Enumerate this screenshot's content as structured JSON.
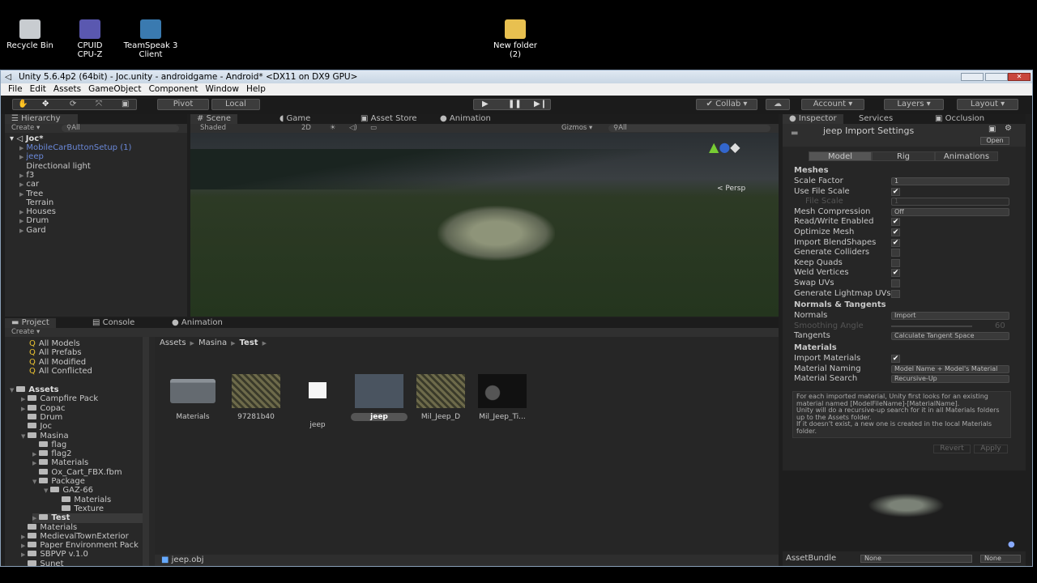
{
  "desktop": {
    "icons": [
      {
        "label": "Recycle Bin"
      },
      {
        "label": "CPUID\nCPU-Z"
      },
      {
        "label": "TeamSpeak 3\nClient"
      },
      {
        "label": "New folder\n(2)"
      }
    ]
  },
  "window": {
    "title": "Unity 5.6.4p2 (64bit) - Joc.unity - androidgame - Android* <DX11 on DX9 GPU>"
  },
  "menu": [
    "File",
    "Edit",
    "Assets",
    "GameObject",
    "Component",
    "Window",
    "Help"
  ],
  "toolbar": {
    "pivot": "Pivot",
    "local": "Local",
    "collab": "Collab",
    "account": "Account",
    "layers": "Layers",
    "layout": "Layout"
  },
  "hierarchy": {
    "tab": "Hierarchy",
    "create": "Create",
    "search_placeholder": "All",
    "scene": "Joc*",
    "items": [
      {
        "label": "MobileCarButtonSetup (1)",
        "prefab": true,
        "arrow": true
      },
      {
        "label": "jeep",
        "prefab": true,
        "arrow": true
      },
      {
        "label": "Directional light",
        "arrow": false
      },
      {
        "label": "f3",
        "arrow": true
      },
      {
        "label": "car",
        "arrow": true
      },
      {
        "label": "Tree",
        "arrow": true
      },
      {
        "label": "Terrain",
        "arrow": false
      },
      {
        "label": "Houses",
        "arrow": true
      },
      {
        "label": "Drum",
        "arrow": true
      },
      {
        "label": "Gard",
        "arrow": true
      }
    ]
  },
  "scene": {
    "tabs": [
      "Scene",
      "Game",
      "Asset Store",
      "Animation"
    ],
    "shading": "Shaded",
    "mode_2d": "2D",
    "gizmos": "Gizmos",
    "search_placeholder": "All",
    "projection": "Persp"
  },
  "project": {
    "tabs": [
      "Project",
      "Console",
      "Animation"
    ],
    "create": "Create",
    "favorites": [
      "All Models",
      "All Prefabs",
      "All Modified",
      "All Conflicted"
    ],
    "tree": [
      {
        "label": "Assets",
        "depth": 0,
        "open": true,
        "bold": true
      },
      {
        "label": "Campfire Pack",
        "depth": 1,
        "arrow": true
      },
      {
        "label": "Copac",
        "depth": 1,
        "arrow": true
      },
      {
        "label": "Drum",
        "depth": 1
      },
      {
        "label": "Joc",
        "depth": 1
      },
      {
        "label": "Masina",
        "depth": 1,
        "open": true
      },
      {
        "label": "flag",
        "depth": 2
      },
      {
        "label": "flag2",
        "depth": 2,
        "arrow": true
      },
      {
        "label": "Materials",
        "depth": 2,
        "arrow": true
      },
      {
        "label": "Ox_Cart_FBX.fbm",
        "depth": 2
      },
      {
        "label": "Package",
        "depth": 2,
        "open": true
      },
      {
        "label": "GAZ-66",
        "depth": 3,
        "open": true
      },
      {
        "label": "Materials",
        "depth": 4
      },
      {
        "label": "Texture",
        "depth": 4
      },
      {
        "label": "Test",
        "depth": 2,
        "arrow": true,
        "selected": true
      },
      {
        "label": "Materials",
        "depth": 1
      },
      {
        "label": "MedievalTownExterior",
        "depth": 1,
        "arrow": true
      },
      {
        "label": "Paper Environment Pack",
        "depth": 1,
        "arrow": true
      },
      {
        "label": "SBPVP v.1.0",
        "depth": 1,
        "arrow": true
      },
      {
        "label": "Sunet",
        "depth": 1
      }
    ],
    "breadcrumb": [
      "Assets",
      "Masina",
      "Test"
    ],
    "assets": [
      {
        "label": "Materials",
        "kind": "folder"
      },
      {
        "label": "97281b40",
        "kind": "texture"
      },
      {
        "label": "jeep",
        "kind": "file"
      },
      {
        "label": "jeep",
        "kind": "model",
        "selected": true
      },
      {
        "label": "Mil_Jeep_D",
        "kind": "texture"
      },
      {
        "label": "Mil_Jeep_Ti...",
        "kind": "texture-dark"
      }
    ],
    "status": "jeep.obj"
  },
  "inspector": {
    "tabs": [
      "Inspector",
      "Services",
      "Occlusion"
    ],
    "title": "jeep Import Settings",
    "open": "Open",
    "subtabs": [
      "Model",
      "Rig",
      "Animations"
    ],
    "meshes_header": "Meshes",
    "meshes": [
      {
        "label": "Scale Factor",
        "type": "field",
        "value": "1"
      },
      {
        "label": "Use File Scale",
        "type": "check",
        "value": true
      },
      {
        "label": "File Scale",
        "type": "field",
        "value": "1",
        "disabled": true
      },
      {
        "label": "Mesh Compression",
        "type": "dropdown",
        "value": "Off"
      },
      {
        "label": "Read/Write Enabled",
        "type": "check",
        "value": true
      },
      {
        "label": "Optimize Mesh",
        "type": "check",
        "value": true
      },
      {
        "label": "Import BlendShapes",
        "type": "check",
        "value": true
      },
      {
        "label": "Generate Colliders",
        "type": "check",
        "value": false
      },
      {
        "label": "Keep Quads",
        "type": "check",
        "value": false
      },
      {
        "label": "Weld Vertices",
        "type": "check",
        "value": true
      },
      {
        "label": "Swap UVs",
        "type": "check",
        "value": false
      },
      {
        "label": "Generate Lightmap UVs",
        "type": "check",
        "value": false
      }
    ],
    "normals_header": "Normals & Tangents",
    "normals": [
      {
        "label": "Normals",
        "type": "dropdown",
        "value": "Import"
      },
      {
        "label": "Smoothing Angle",
        "type": "slider",
        "value": "60",
        "disabled": true
      },
      {
        "label": "Tangents",
        "type": "dropdown",
        "value": "Calculate Tangent Space"
      }
    ],
    "materials_header": "Materials",
    "materials": [
      {
        "label": "Import Materials",
        "type": "check",
        "value": true
      },
      {
        "label": "Material Naming",
        "type": "dropdown",
        "value": "Model Name + Model's Material"
      },
      {
        "label": "Material Search",
        "type": "dropdown",
        "value": "Recursive-Up"
      }
    ],
    "help": "For each imported material, Unity first looks for an existing material named [ModelFileName]-[MaterialName].\nUnity will do a recursive-up search for it in all Materials folders up to the Assets folder.\nIf it doesn't exist, a new one is created in the local Materials folder.",
    "revert": "Revert",
    "apply": "Apply",
    "assetbundle_label": "AssetBundle",
    "assetbundle_value": "None",
    "variant_value": "None"
  }
}
